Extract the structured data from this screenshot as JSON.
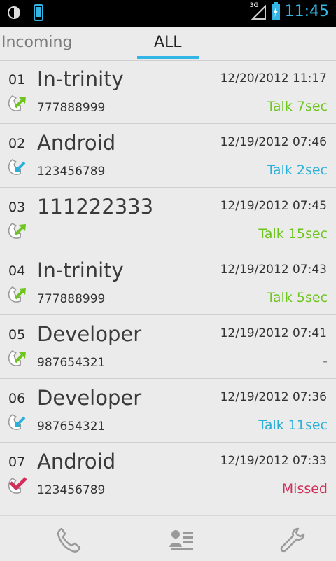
{
  "status_bar": {
    "time": "11:45",
    "network": "3G",
    "icons": [
      "brightness-icon",
      "phone-device-icon",
      "signal-icon",
      "battery-charging-icon"
    ]
  },
  "tabs": [
    {
      "label": "Incoming",
      "active": false
    },
    {
      "label": "ALL",
      "active": true
    }
  ],
  "accent": "#33b5e5",
  "calls": [
    {
      "index": "01",
      "name": "In-trinity",
      "date": "12/20/2012 11:17",
      "number": "777888999",
      "status": "Talk 7sec",
      "type": "outgoing"
    },
    {
      "index": "02",
      "name": "Android",
      "date": "12/19/2012 07:46",
      "number": "123456789",
      "status": "Talk 2sec",
      "type": "incoming"
    },
    {
      "index": "03",
      "name": "111222333",
      "date": "12/19/2012 07:45",
      "number": "",
      "status": "Talk 15sec",
      "type": "outgoing"
    },
    {
      "index": "04",
      "name": "In-trinity",
      "date": "12/19/2012 07:43",
      "number": "777888999",
      "status": "Talk 5sec",
      "type": "outgoing"
    },
    {
      "index": "05",
      "name": "Developer",
      "date": "12/19/2012 07:41",
      "number": "987654321",
      "status": "-",
      "type": "outgoing"
    },
    {
      "index": "06",
      "name": "Developer",
      "date": "12/19/2012 07:36",
      "number": "987654321",
      "status": "Talk 11sec",
      "type": "incoming"
    },
    {
      "index": "07",
      "name": "Android",
      "date": "12/19/2012 07:33",
      "number": "123456789",
      "status": "Missed",
      "type": "missed"
    }
  ],
  "status_colors": {
    "outgoing": "#6ec51e",
    "incoming": "#2ab0d8",
    "missed": "#d12e5a",
    "none": "#888888"
  },
  "bottom_bar": [
    "phone-icon",
    "contacts-icon",
    "settings-wrench-icon"
  ]
}
